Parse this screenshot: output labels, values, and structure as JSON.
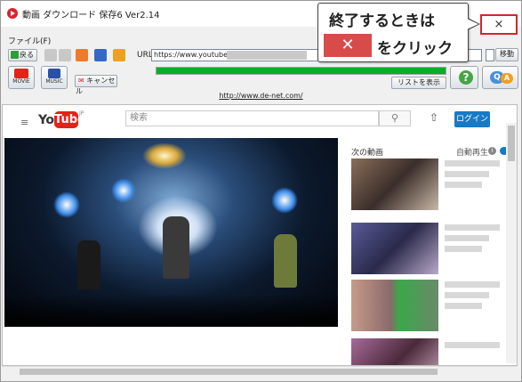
{
  "window": {
    "title": "動画 ダウンロード 保存6 Ver2.14",
    "close_glyph": "×"
  },
  "menu": {
    "file": "ファイル(F)"
  },
  "toolbar": {
    "back_label": "戻る",
    "url_label": "URL",
    "url_value": "https://www.youtube.com/",
    "move_label": "移動"
  },
  "actions": {
    "movie_label": "MOVIE",
    "music_label": "MUSIC",
    "cancel_label": "キャンセル",
    "list_label": "リストを表示",
    "help_glyph": "?",
    "qa_glyph_q": "Q",
    "qa_glyph_a": "A",
    "progress_fraction": 1.0
  },
  "link_bar": {
    "url": "http://www.de-net.com/"
  },
  "youtube": {
    "logo_you": "You",
    "logo_tube": "Tube",
    "logo_region": "JP",
    "search_placeholder": "検索",
    "login_label": "ログイン",
    "next_label": "次の動画",
    "autoplay_label": "自動再生",
    "info_glyph": "i"
  },
  "callout": {
    "line1": "終了するときは",
    "x_glyph": "✕",
    "line2": "をクリック"
  },
  "colors": {
    "accent_red": "#d9232d",
    "youtube_red": "#e62117",
    "login_blue": "#167ac6",
    "progress_green": "#06b025",
    "callout_x_bg": "#d84b4b"
  }
}
